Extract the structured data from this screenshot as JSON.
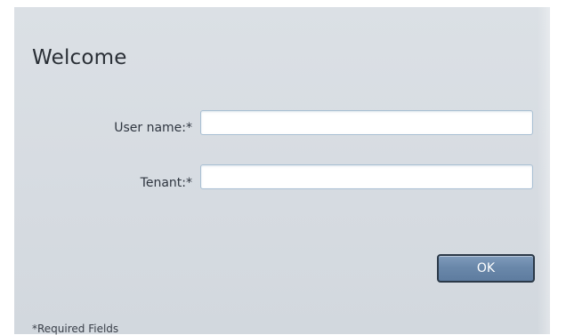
{
  "dialog": {
    "title": "Welcome",
    "fields": {
      "username": {
        "label": "User name:*",
        "value": "",
        "placeholder": ""
      },
      "tenant": {
        "label": "Tenant:*",
        "value": "",
        "placeholder": ""
      }
    },
    "ok_label": "OK",
    "required_note": "*Required Fields"
  },
  "colors": {
    "background": "#d6dbe1",
    "button": "#6a88aa",
    "button_border": "#2b3948",
    "field_border": "#a9bfd3"
  }
}
